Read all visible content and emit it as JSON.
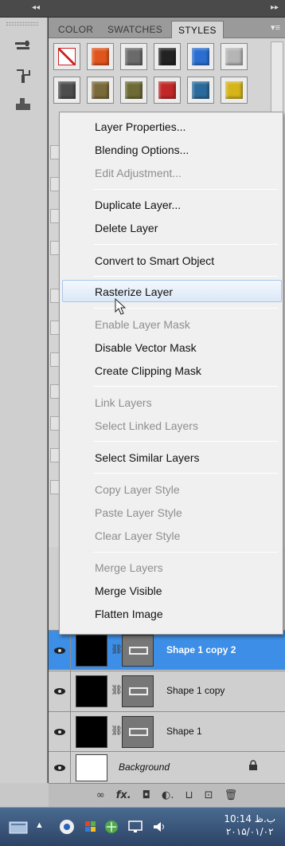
{
  "topstrip": {
    "collapse_left": "◂◂",
    "collapse_right": "▸▸"
  },
  "panel_tabs": [
    "COLOR",
    "SWATCHES",
    "STYLES"
  ],
  "active_tab": "STYLES",
  "panel_menu_icon": "▾≡",
  "tool_icons": [
    "brush-presets-icon",
    "clone-source-icon",
    "tool-presets-icon"
  ],
  "styles": [
    {
      "name": "style-none",
      "color": "#ffffff"
    },
    {
      "name": "style-orange-glow",
      "color": "#e0551d"
    },
    {
      "name": "style-gray",
      "color": "#6a6a6a"
    },
    {
      "name": "style-black-chrome",
      "color": "#222222"
    },
    {
      "name": "style-blue-glass",
      "color": "#2a6fcf"
    },
    {
      "name": "style-light-gray",
      "color": "#b5b5b5"
    },
    {
      "name": "style-dark-gradient",
      "color": "#4d4d4d"
    },
    {
      "name": "style-bronze",
      "color": "#7a6a3a"
    },
    {
      "name": "style-olive",
      "color": "#6e6a35"
    },
    {
      "name": "style-red",
      "color": "#c02828"
    },
    {
      "name": "style-mosaic",
      "color": "#2a6a9a"
    },
    {
      "name": "style-yellow",
      "color": "#d6b51a"
    }
  ],
  "context_menu": {
    "items": [
      {
        "label": "Layer Properties...",
        "enabled": true
      },
      {
        "label": "Blending Options...",
        "enabled": true
      },
      {
        "label": "Edit Adjustment...",
        "enabled": false
      },
      {
        "label": "Duplicate Layer...",
        "enabled": true
      },
      {
        "label": "Delete Layer",
        "enabled": true
      },
      {
        "label": "Convert to Smart Object",
        "enabled": true
      },
      {
        "label": "Rasterize Layer",
        "enabled": true,
        "highlighted": true
      },
      {
        "label": "Enable Layer Mask",
        "enabled": false
      },
      {
        "label": "Disable Vector Mask",
        "enabled": true
      },
      {
        "label": "Create Clipping Mask",
        "enabled": true
      },
      {
        "label": "Link Layers",
        "enabled": false
      },
      {
        "label": "Select Linked Layers",
        "enabled": false
      },
      {
        "label": "Select Similar Layers",
        "enabled": true
      },
      {
        "label": "Copy Layer Style",
        "enabled": false
      },
      {
        "label": "Paste Layer Style",
        "enabled": false
      },
      {
        "label": "Clear Layer Style",
        "enabled": false
      },
      {
        "label": "Merge Layers",
        "enabled": false
      },
      {
        "label": "Merge Visible",
        "enabled": true
      },
      {
        "label": "Flatten Image",
        "enabled": true
      }
    ]
  },
  "layers": [
    {
      "name": "Shape 1 copy 2",
      "selected": true,
      "thumb": "black",
      "has_mask": true
    },
    {
      "name": "Shape 1 copy",
      "selected": false,
      "thumb": "black",
      "has_mask": true
    },
    {
      "name": "Shape 1",
      "selected": false,
      "thumb": "black",
      "has_mask": true
    },
    {
      "name": "Background",
      "selected": false,
      "thumb": "white",
      "has_mask": false,
      "locked": true
    }
  ],
  "layer_footer_icons": [
    "link-icon",
    "fx-icon",
    "add-mask-icon",
    "adjustment-icon",
    "group-icon",
    "new-layer-icon",
    "delete-icon"
  ],
  "layer_footer_labels": {
    "link": "∞",
    "fx": "fx.",
    "mask": "◘",
    "adjustment": "◐.",
    "group": "⊔",
    "new": "⊡",
    "delete": "🗑"
  },
  "taskbar": {
    "time": "10:14 ب.ظ",
    "date": "۲۰۱۵/۰۱/۰۲",
    "icons": [
      "start-icon",
      "arrow-up-icon",
      "chrome-icon",
      "flag-icon",
      "network-icon",
      "monitor-icon",
      "volume-icon"
    ],
    "arrow_label": "▲"
  }
}
